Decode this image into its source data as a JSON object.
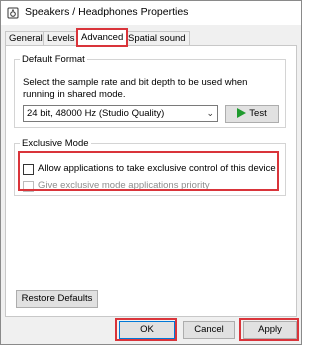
{
  "window": {
    "title": "Speakers / Headphones Properties",
    "icon": "speaker-icon"
  },
  "tabs": [
    {
      "label": "General",
      "active": false
    },
    {
      "label": "Levels",
      "active": false
    },
    {
      "label": "Advanced",
      "active": true
    },
    {
      "label": "Spatial sound",
      "active": false
    }
  ],
  "default_format": {
    "legend": "Default Format",
    "description": "Select the sample rate and bit depth to be used when running in shared mode.",
    "selected_format": "24 bit, 48000 Hz (Studio Quality)",
    "test_label": "Test"
  },
  "exclusive_mode": {
    "legend": "Exclusive Mode",
    "allow_label": "Allow applications to take exclusive control of this device",
    "allow_checked": false,
    "priority_label": "Give exclusive mode applications priority",
    "priority_checked": false,
    "priority_enabled": false
  },
  "restore_defaults_label": "Restore Defaults",
  "footer": {
    "ok_label": "OK",
    "cancel_label": "Cancel",
    "apply_label": "Apply"
  },
  "colors": {
    "highlight": "#d9343a",
    "test_icon": "#1f9a2e",
    "focus_blue": "#0078d7"
  }
}
